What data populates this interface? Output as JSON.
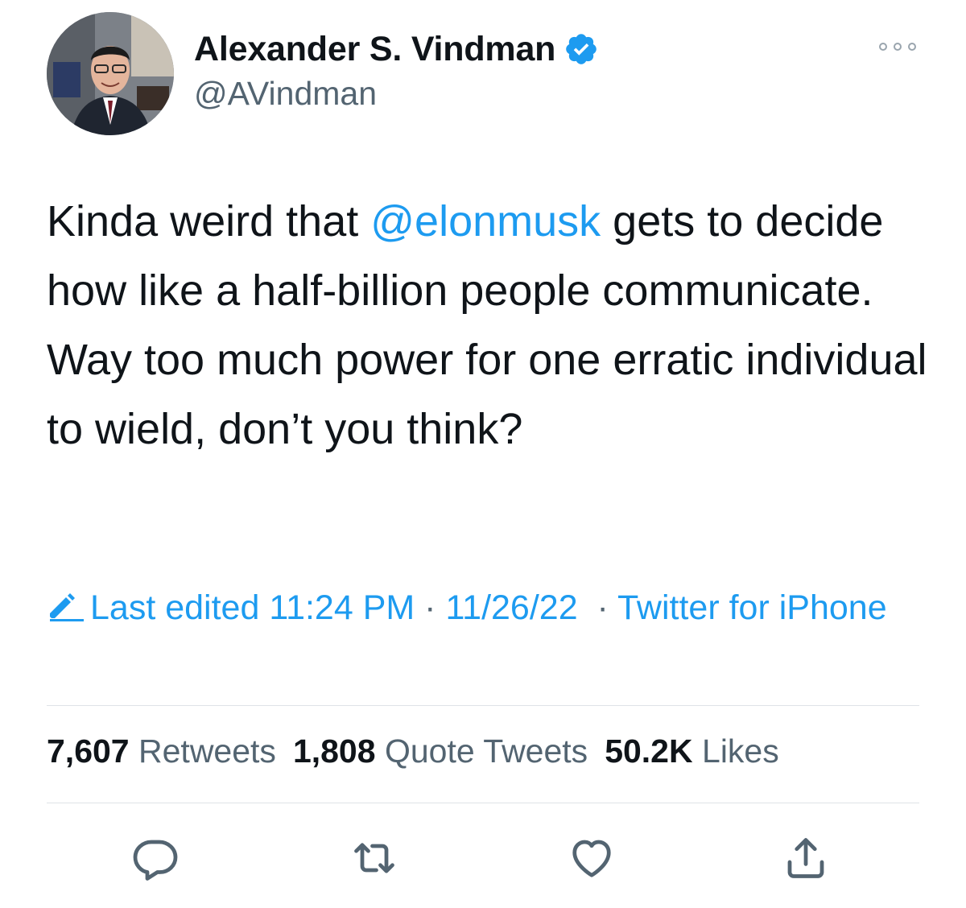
{
  "author": {
    "name": "Alexander S. Vindman",
    "handle": "@AVindman",
    "verified": true
  },
  "tweet": {
    "text_before": "Kinda weird that ",
    "mention": "@elonmusk",
    "text_after": " gets to decide how like a half-billion people communicate. Way too much power for one erratic individual to wield, don’t you think?"
  },
  "meta": {
    "edited_label": "Last edited",
    "time": "11:24 PM",
    "separator": " · ",
    "date": "11/26/22",
    "source": "Twitter for iPhone"
  },
  "stats": {
    "retweets_count": "7,607",
    "retweets_label": "Retweets",
    "quotes_count": "1,808",
    "quotes_label": "Quote Tweets",
    "likes_count": "50.2K",
    "likes_label": "Likes"
  },
  "icons": {
    "verified": "verified-badge-icon",
    "more": "more-options-icon",
    "edit": "edit-pencil-icon",
    "reply": "reply-icon",
    "retweet": "retweet-icon",
    "like": "heart-icon",
    "share": "share-icon"
  },
  "colors": {
    "accent": "#1d9bf0",
    "text": "#0f1419",
    "secondary": "#536471",
    "divider": "#dfe3e7"
  }
}
